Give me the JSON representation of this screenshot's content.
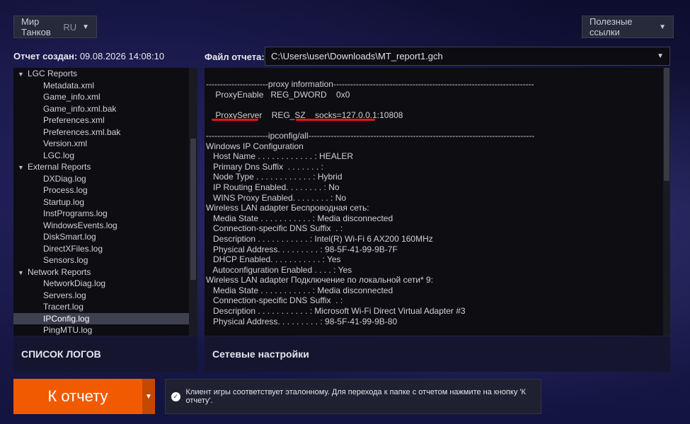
{
  "header": {
    "game_select": {
      "label": "Мир Танков",
      "region": "RU"
    },
    "links_select": {
      "label": "Полезные ссылки"
    }
  },
  "report": {
    "created_label": "Отчет создан:",
    "created_value": "09.08.2026 14:08:10",
    "file_label": "Файл отчета:",
    "file_path": "C:\\Users\\user\\Downloads\\MT_report1.gch"
  },
  "tree": {
    "items": [
      {
        "type": "folder",
        "label": "LGC Reports"
      },
      {
        "type": "leaf",
        "label": "Metadata.xml"
      },
      {
        "type": "leaf",
        "label": "Game_info.xml"
      },
      {
        "type": "leaf",
        "label": "Game_info.xml.bak"
      },
      {
        "type": "leaf",
        "label": "Preferences.xml"
      },
      {
        "type": "leaf",
        "label": "Preferences.xml.bak"
      },
      {
        "type": "leaf",
        "label": "Version.xml"
      },
      {
        "type": "leaf",
        "label": "LGC.log"
      },
      {
        "type": "folder",
        "label": "External Reports"
      },
      {
        "type": "leaf",
        "label": "DXDiag.log"
      },
      {
        "type": "leaf",
        "label": "Process.log"
      },
      {
        "type": "leaf",
        "label": "Startup.log"
      },
      {
        "type": "leaf",
        "label": "InstPrograms.log"
      },
      {
        "type": "leaf",
        "label": "WindowsEvents.log"
      },
      {
        "type": "leaf",
        "label": "DiskSmart.log"
      },
      {
        "type": "leaf",
        "label": "DirectXFiles.log"
      },
      {
        "type": "leaf",
        "label": "Sensors.log"
      },
      {
        "type": "folder",
        "label": "Network Reports"
      },
      {
        "type": "leaf",
        "label": "NetworkDiag.log"
      },
      {
        "type": "leaf",
        "label": "Servers.log"
      },
      {
        "type": "leaf",
        "label": "Tracert.log"
      },
      {
        "type": "leaf",
        "label": "IPConfig.log",
        "selected": true
      },
      {
        "type": "leaf",
        "label": "PingMTU.log"
      }
    ]
  },
  "left_footer": {
    "label": "СПИСОК ЛОГОВ"
  },
  "right_footer": {
    "label": "Сетевые настройки"
  },
  "log_lines": [
    "----------------------proxy information-----------------------------------------------------------------------",
    "    ProxyEnable   REG_DWORD    0x0",
    "",
    "    ProxyServer    REG_SZ    socks=127.0.0.1:10808",
    "",
    "----------------------ipconfig/all--------------------------------------------------------------------------------",
    "Windows IP Configuration",
    "   Host Name . . . . . . . . . . . . : HEALER",
    "   Primary Dns Suffix  . . . . . . . :",
    "   Node Type . . . . . . . . . . . . : Hybrid",
    "   IP Routing Enabled. . . . . . . . : No",
    "   WINS Proxy Enabled. . . . . . . . : No",
    "Wireless LAN adapter Беспроводная сеть:",
    "   Media State . . . . . . . . . . . : Media disconnected",
    "   Connection-specific DNS Suffix  . :",
    "   Description . . . . . . . . . . . : Intel(R) Wi-Fi 6 AX200 160MHz",
    "   Physical Address. . . . . . . . . : 98-5F-41-99-9B-7F",
    "   DHCP Enabled. . . . . . . . . . . : Yes",
    "   Autoconfiguration Enabled . . . . : Yes",
    "Wireless LAN adapter Подключение по локальной сети* 9:",
    "   Media State . . . . . . . . . . . : Media disconnected",
    "   Connection-specific DNS Suffix  . :",
    "   Description . . . . . . . . . . . : Microsoft Wi-Fi Direct Virtual Adapter #3",
    "   Physical Address. . . . . . . . . : 98-5F-41-99-9B-80"
  ],
  "actions": {
    "to_report": "К отчету"
  },
  "notice": {
    "text": "Клиент игры соответствует эталонному. Для перехода к папке с отчетом нажмите на кнопку 'К отчету'."
  },
  "colors": {
    "accent": "#f25a00",
    "highlight": "#e01818"
  }
}
